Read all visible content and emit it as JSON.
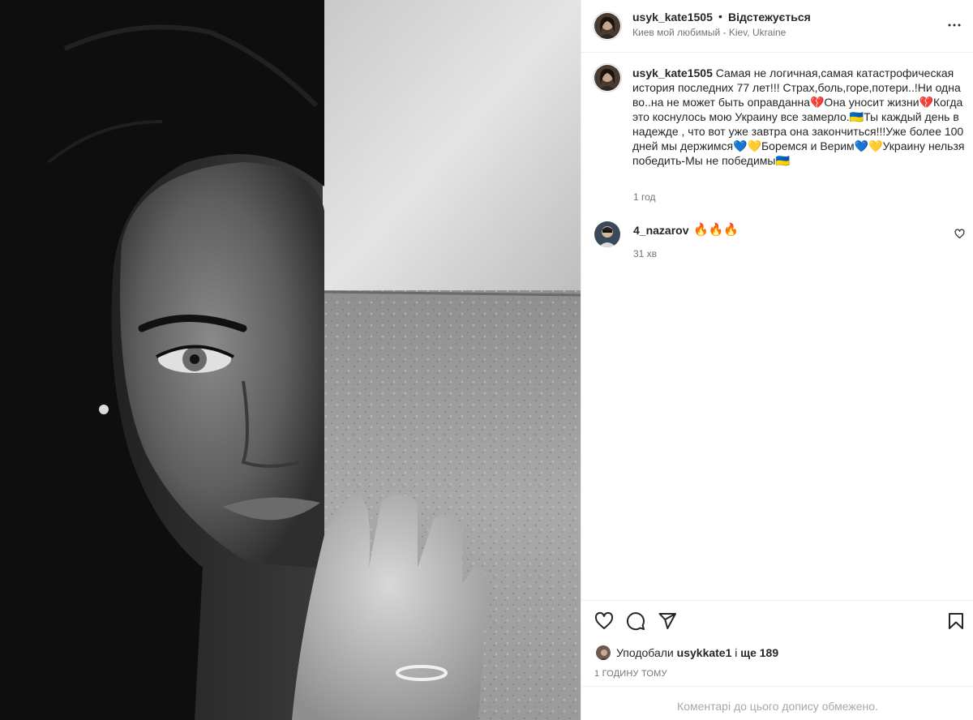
{
  "post": {
    "author": "usyk_kate1505",
    "separator": "•",
    "follow_status": "Відстежується",
    "location": "Киев мой любимый - Kiev, Ukraine",
    "caption": "Самая не логичная,самая катастрофическая история последних 77 лет!!! Страх,боль,горе,потери..!Ни одна во..на не может быть оправданна💔Она уносит жизни💔Когда это коснулось мою Украину все замерло.🇺🇦Ты каждый день в надежде , что вот уже завтра она закончиться!!!Уже более 100 дней мы держимся💙💛Боремся и Верим💙💛Украину нельзя победить-Мы не победимы🇺🇦",
    "caption_time": "1 год"
  },
  "comments": [
    {
      "user": "4_nazarov",
      "text": "🔥🔥🔥",
      "time": "31 хв"
    }
  ],
  "likes": {
    "prefix": "Уподобали",
    "user": "usykkate1",
    "middle": "і",
    "rest": "ще 189"
  },
  "post_time": "1 ГОДИНУ ТОМУ",
  "footer_notice": "Коментарі до цього допису обмежено.",
  "icons": {
    "more": "more-horizontal-icon",
    "like": "heart-icon",
    "comment": "comment-icon",
    "share": "send-icon",
    "save": "bookmark-icon"
  },
  "colors": {
    "text": "#262626",
    "secondary": "#737373",
    "muted": "#a8a8a8",
    "divider": "#efefef"
  }
}
